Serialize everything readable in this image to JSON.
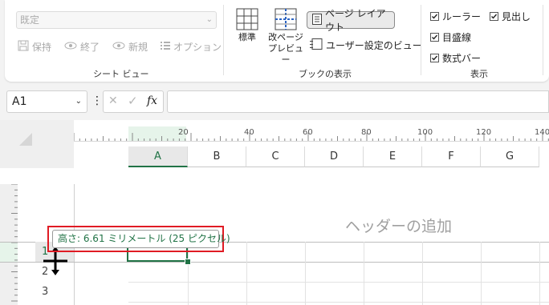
{
  "ribbon": {
    "sheet_view": {
      "dropdown_value": "既定",
      "buttons": [
        "保持",
        "終了",
        "新規",
        "オプション"
      ],
      "group_label": "シート ビュー"
    },
    "workbook_views": {
      "normal_label": "標準",
      "page_break_label_1": "改ページ",
      "page_break_label_2": "プレビュー",
      "page_layout_label": "ページ レイアウト",
      "custom_views_label": "ユーザー設定のビュー",
      "group_label": "ブックの表示"
    },
    "show": {
      "ruler": "ルーラー",
      "headings": "見出し",
      "gridlines": "目盛線",
      "formula_bar": "数式バー",
      "group_label": "表示"
    }
  },
  "formula_bar": {
    "name_box": "A1",
    "fx": "fx",
    "more": "⋮",
    "cancel": "✕",
    "enter": "✓",
    "content": ""
  },
  "sheet": {
    "ruler_ticks": [
      "20",
      "40",
      "60",
      "80",
      "100",
      "120",
      "140"
    ],
    "columns": [
      "A",
      "B",
      "C",
      "D",
      "E",
      "F",
      "G"
    ],
    "rows": [
      "1",
      "2",
      "3"
    ],
    "header_placeholder": "ヘッダーの追加",
    "tooltip": "高さ: 6.61 ミリメートル (25 ピクセル)"
  },
  "colors": {
    "accent_green": "#217346",
    "highlight_red": "#e01b24"
  }
}
